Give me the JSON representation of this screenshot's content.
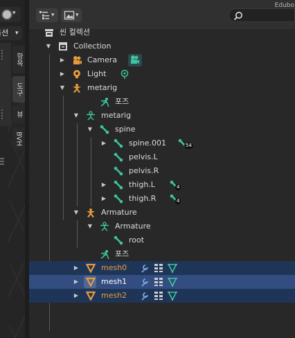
{
  "viewport": {
    "options_label": "옵션",
    "side_tabs": [
      "항목",
      "도구",
      "뷰",
      "BVH"
    ]
  },
  "outliner": {
    "search": {
      "placeholder": "",
      "overflow_text": "Edubo"
    },
    "colors": {
      "orange": "#e79a3c",
      "green": "#3fc3a0",
      "blue": "#76a8e0",
      "selected_row": "#1f3558",
      "active_row": "#334d80"
    },
    "rows": [
      {
        "label": "씬 컬렉션",
        "icon": "scene-collection-icon"
      },
      {
        "label": "Collection",
        "icon": "collection-icon",
        "expanded": true
      },
      {
        "label": "Camera",
        "icon": "camera-object-icon",
        "extra_icon": "camera-data-icon"
      },
      {
        "label": "Light",
        "icon": "light-object-icon",
        "extra_icon": "light-data-icon"
      },
      {
        "label": "metarig",
        "icon": "armature-object-icon",
        "expanded": true
      },
      {
        "label": "포즈",
        "icon": "pose-icon"
      },
      {
        "label": "metarig",
        "icon": "armature-data-icon",
        "expanded": true
      },
      {
        "label": "spine",
        "icon": "bone-icon",
        "expanded": true
      },
      {
        "label": "spine.001",
        "icon": "bone-icon",
        "badge_icon": "bone-icon",
        "badge": "54"
      },
      {
        "label": "pelvis.L",
        "icon": "bone-icon"
      },
      {
        "label": "pelvis.R",
        "icon": "bone-icon"
      },
      {
        "label": "thigh.L",
        "icon": "bone-icon",
        "badge_icon": "bone-icon",
        "badge": "4"
      },
      {
        "label": "thigh.R",
        "icon": "bone-icon",
        "badge_icon": "bone-icon",
        "badge": "4"
      },
      {
        "label": "Armature",
        "icon": "armature-object-icon",
        "expanded": true
      },
      {
        "label": "Armature",
        "icon": "armature-data-icon",
        "expanded": true
      },
      {
        "label": "root",
        "icon": "bone-icon"
      },
      {
        "label": "포즈",
        "icon": "pose-icon"
      },
      {
        "label": "mesh0",
        "icon": "mesh-object-icon",
        "state": "selected"
      },
      {
        "label": "mesh1",
        "icon": "mesh-object-icon",
        "state": "active"
      },
      {
        "label": "mesh2",
        "icon": "mesh-object-icon",
        "state": "selected"
      }
    ],
    "mesh_extra_icons": [
      "modifier-wrench-icon",
      "vertex-groups-icon",
      "mesh-data-icon"
    ]
  }
}
